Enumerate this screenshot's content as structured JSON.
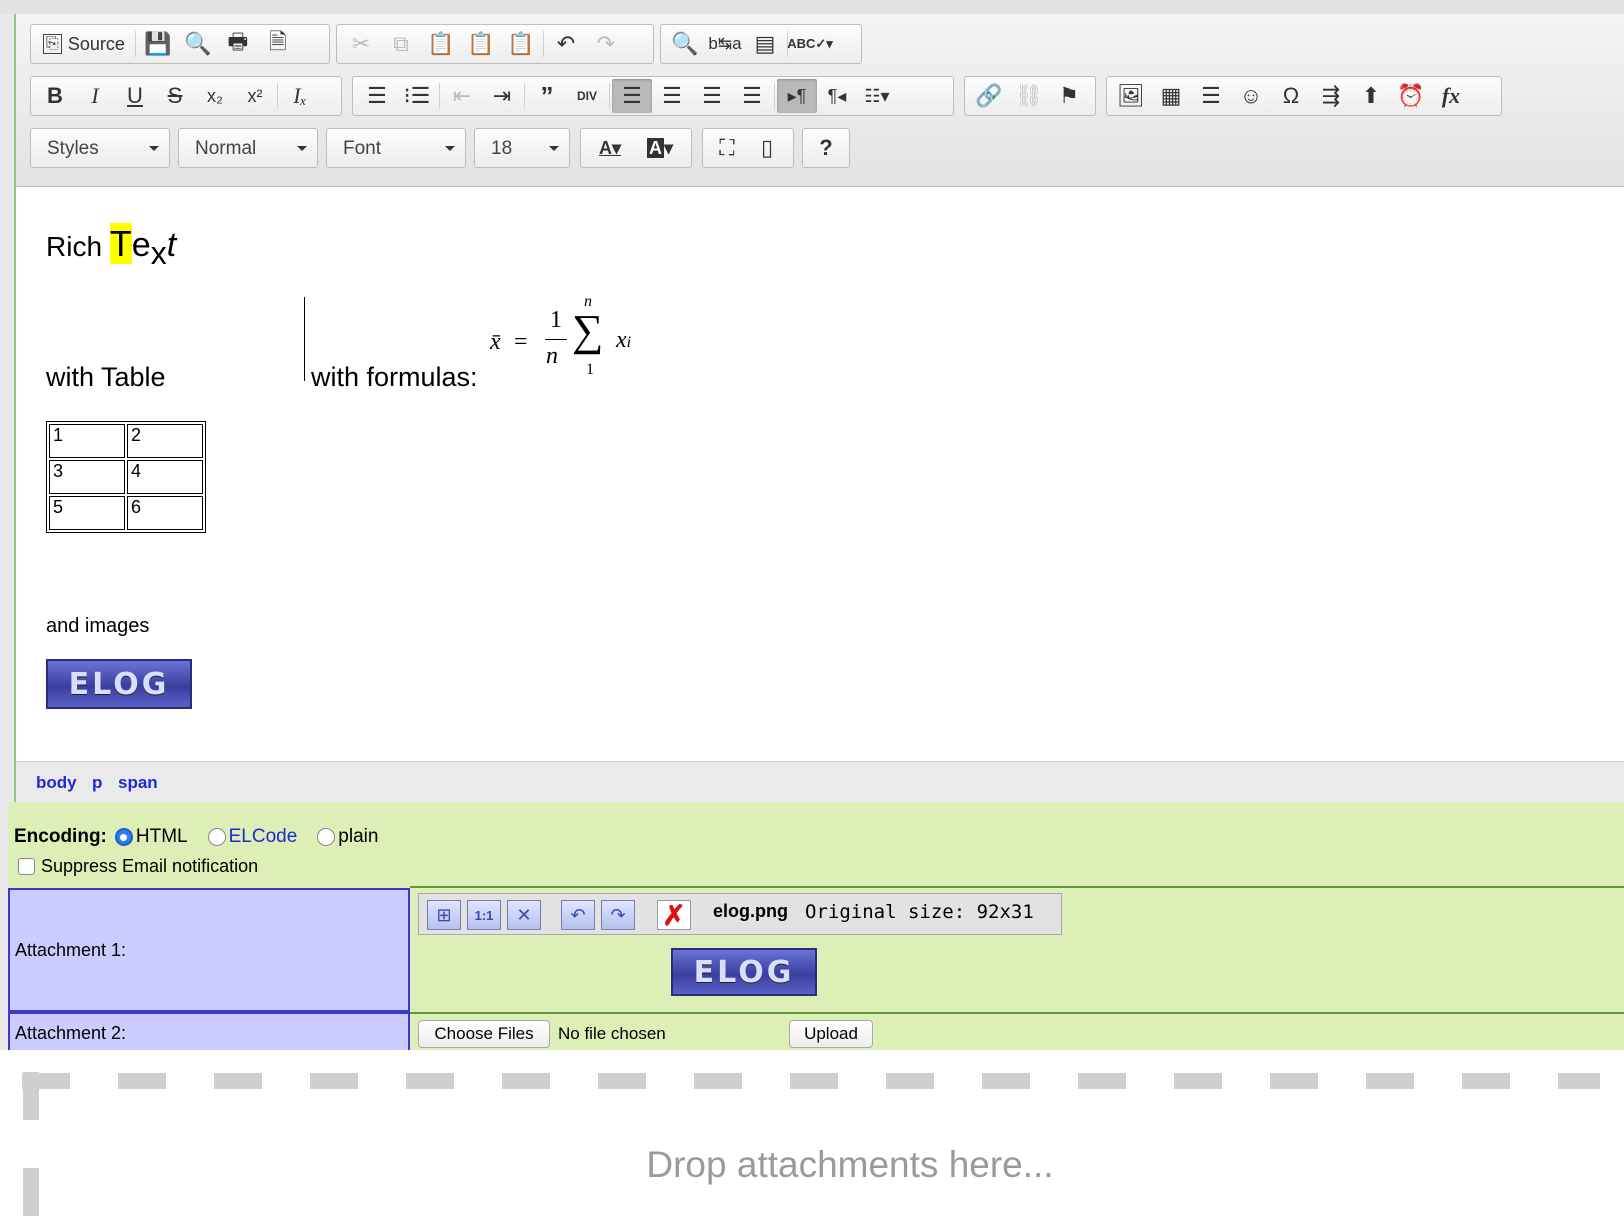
{
  "toolbar": {
    "source_label": "Source",
    "styles_label": "Styles",
    "format_label": "Normal",
    "font_label": "Font",
    "size_label": "18",
    "help_label": "?"
  },
  "content": {
    "rich": "Rich ",
    "t1": "T",
    "t2": "e",
    "t3": "x",
    "t4": "t",
    "with_table": "with Table",
    "with_formulas": "with formulas:",
    "formula": {
      "xbar": "x̄",
      "eq": "=",
      "num": "1",
      "den": "n",
      "sigma": "∑",
      "upper": "n",
      "lower": "1",
      "xi_x": "x",
      "xi_i": "i"
    },
    "table": [
      [
        "1",
        "2"
      ],
      [
        "3",
        "4"
      ],
      [
        "5",
        "6"
      ]
    ],
    "and_images": "and images",
    "elog_text": "ELOG"
  },
  "pathbar": [
    "body",
    "p",
    "span"
  ],
  "encoding": {
    "label": "Encoding:",
    "options": [
      "HTML",
      "ELCode",
      "plain"
    ],
    "selected": "HTML"
  },
  "suppress_email": "Suppress Email notification",
  "attachments": {
    "label1": "Attachment 1:",
    "file_name": "elog.png",
    "size_text": "Original size: 92x31",
    "label2": "Attachment 2:",
    "choose_files": "Choose Files",
    "no_file": "No file chosen",
    "upload": "Upload"
  },
  "dropzone_text": "Drop attachments here...",
  "colors": {
    "accent_green": "#ddeeb6",
    "attachment_label_bg": "#cacbff",
    "link_blue": "#1d2ad6",
    "highlight_yellow": "#ffff00"
  }
}
